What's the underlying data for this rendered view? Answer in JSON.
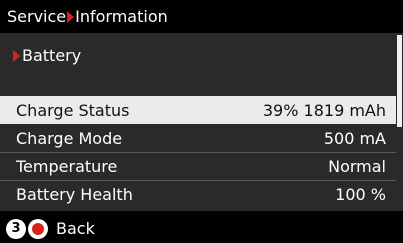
{
  "title": {
    "part1": "Service",
    "part2": "Information",
    "separator_icon": "breadcrumb-arrow-icon"
  },
  "section": {
    "label": "Battery",
    "icon": "red-arrow-icon"
  },
  "rows": [
    {
      "label": "Charge Status",
      "value": "39% 1819 mAh"
    },
    {
      "label": "Charge Mode",
      "value": "500 mA"
    },
    {
      "label": "Temperature",
      "value": "Normal"
    },
    {
      "label": "Battery Health",
      "value": "100 %"
    }
  ],
  "footer": {
    "button_number": "3",
    "back_label": "Back"
  },
  "colors": {
    "accent": "#d8211b",
    "selected_bg": "#ebebeb",
    "panel_bg": "#2a2a2a"
  }
}
